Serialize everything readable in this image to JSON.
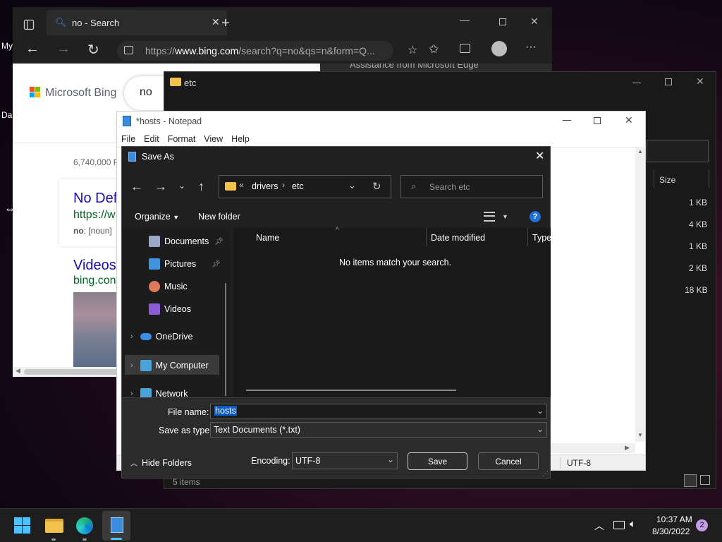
{
  "desktop": {
    "left_label_1": "My",
    "left_label_2": "Da"
  },
  "edge": {
    "tab_title": "no - Search",
    "url_prefix": "https://",
    "url_domain": "www.bing.com",
    "url_rest": "/search?q=no&qs=n&form=Q...",
    "copilot_title": "Assistance from Microsoft Edge",
    "bing_logo": "Microsoft Bing",
    "search_query": "no",
    "results_count": "6,740,000 R",
    "result1_title": "No Def",
    "result1_url": "https://w",
    "result1_snippet_bold": "no",
    "result1_snippet": ": [noun]",
    "result2_title": "Videos",
    "result2_url": "bing.con"
  },
  "explorer": {
    "title": "etc",
    "col_size": "Size",
    "sizes": [
      "1 KB",
      "4 KB",
      "1 KB",
      "2 KB",
      "18 KB"
    ],
    "status_items": "5 items"
  },
  "notepad": {
    "title": "*hosts - Notepad",
    "menu": [
      "File",
      "Edit",
      "Format",
      "View",
      "Help"
    ],
    "encoding_status": "UTF-8"
  },
  "saveas": {
    "title": "Save As",
    "breadcrumb": [
      "drivers",
      "etc"
    ],
    "search_placeholder": "Search etc",
    "organize": "Organize",
    "new_folder": "New folder",
    "columns": {
      "name": "Name",
      "date": "Date modified",
      "type": "Type"
    },
    "empty_message": "No items match your search.",
    "nav": [
      {
        "label": "Documents",
        "pinned": true
      },
      {
        "label": "Pictures",
        "pinned": true
      },
      {
        "label": "Music",
        "pinned": false
      },
      {
        "label": "Videos",
        "pinned": false
      },
      {
        "label": "OneDrive",
        "pinned": false
      },
      {
        "label": "My Computer",
        "pinned": false
      },
      {
        "label": "Network",
        "pinned": false
      }
    ],
    "file_name_label": "File name:",
    "file_name_value": "hosts",
    "save_type_label": "Save as type:",
    "save_type_value": "Text Documents (*.txt)",
    "hide_folders": "Hide Folders",
    "encoding_label": "Encoding:",
    "encoding_value": "UTF-8",
    "save": "Save",
    "cancel": "Cancel"
  },
  "taskbar": {
    "time": "10:37 AM",
    "date": "8/30/2022",
    "notification_count": "2"
  },
  "colors": {
    "accent": "#0078d4",
    "bing_link": "#1a0dab",
    "selection": "#0a5bc4"
  }
}
